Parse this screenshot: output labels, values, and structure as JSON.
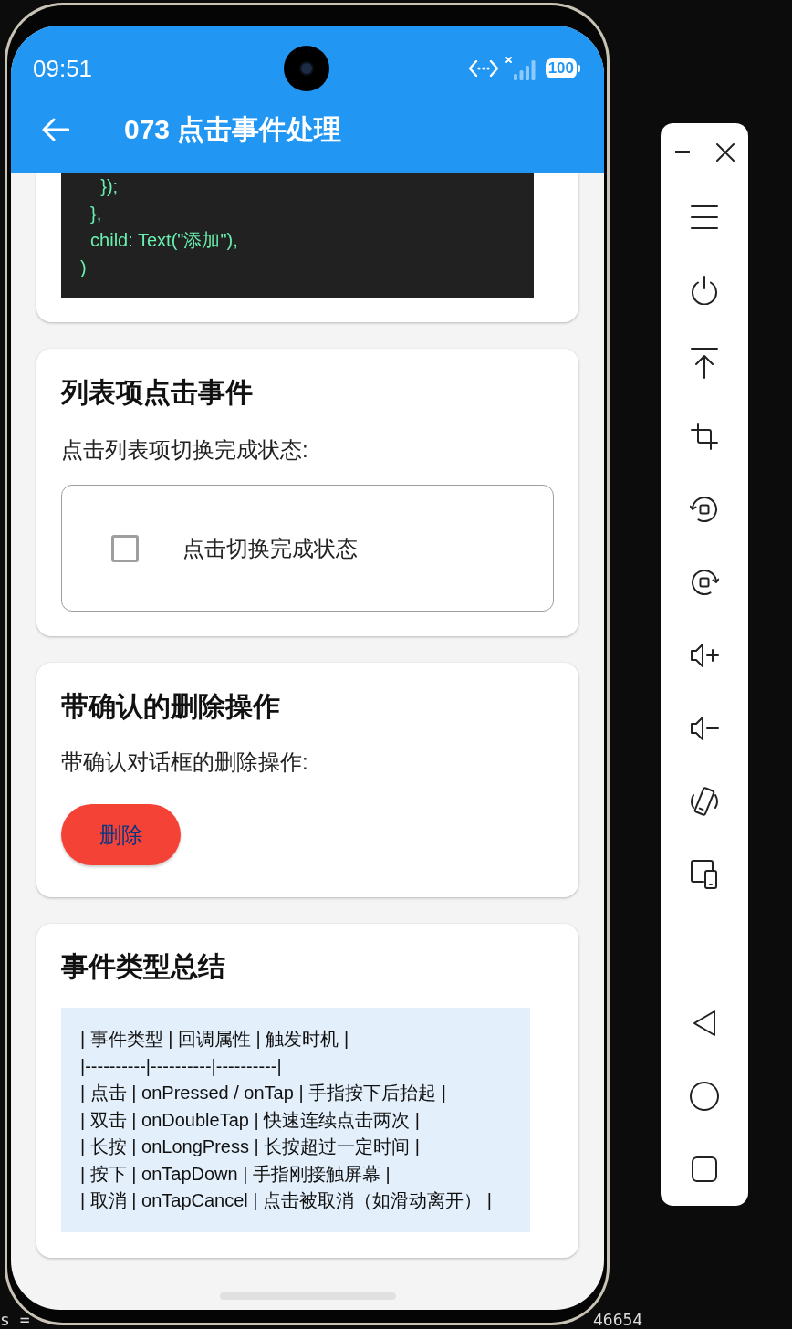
{
  "status_bar": {
    "time": "09:51",
    "battery": "100"
  },
  "app_bar": {
    "title": "073 点击事件处理"
  },
  "cards": [
    {
      "kind": "code",
      "code_lines": [
        "    });",
        "  },",
        "  child: Text(\"添加\"),",
        ")"
      ]
    },
    {
      "kind": "list_tile",
      "title": "列表项点击事件",
      "description": "点击列表项切换完成状态:",
      "tile": {
        "label": "点击切换完成状态",
        "checked": false
      }
    },
    {
      "kind": "button",
      "title": "带确认的删除操作",
      "description": "带确认对话框的删除操作:",
      "button": {
        "label": "删除"
      }
    },
    {
      "kind": "summary",
      "title": "事件类型总结",
      "lines": [
        "| 事件类型 | 回调属性 | 触发时机 |",
        "|----------|----------|----------|",
        "| 点击 | onPressed / onTap | 手指按下后抬起 |",
        "| 双击 | onDoubleTap | 快速连续点击两次 |",
        "| 长按 | onLongPress | 长按超过一定时间 |",
        "| 按下 | onTapDown | 手指刚接触屏幕 |",
        "| 取消 | onTapCancel | 点击被取消（如滑动离开） |"
      ]
    }
  ],
  "background_text": [
    "s =",
    "46654"
  ]
}
